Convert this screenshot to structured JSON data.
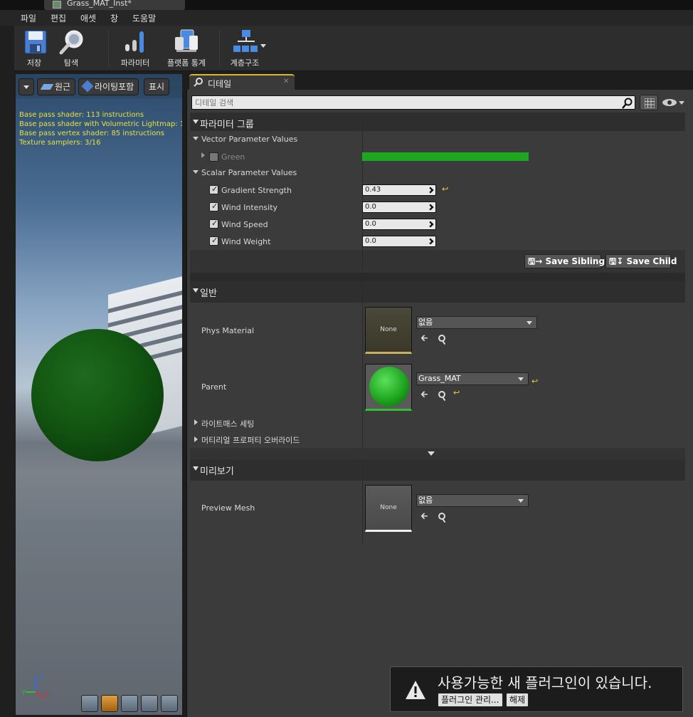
{
  "document_tab": {
    "title": "Grass_MAT_Inst*"
  },
  "menu": [
    "파일",
    "편집",
    "애셋",
    "창",
    "도움말"
  ],
  "toolbar": {
    "save_label": "저장",
    "browse_label": "탐색",
    "params_label": "파라미터",
    "platform_label": "플랫폼 통계",
    "hierarchy_label": "계층구조"
  },
  "viewport": {
    "perspective_label": "원근",
    "lighting_label": "라이팅포함",
    "show_label": "표시",
    "stats": [
      "Base pass shader: 113 instructions",
      "Base pass shader with Volumetric Lightmap: 1",
      "Base pass vertex shader: 85 instructions",
      "Texture samplers: 3/16"
    ],
    "gizmo": {
      "z": "Z",
      "y": "Y",
      "x": "X"
    }
  },
  "details": {
    "tab_label": "디테일",
    "tab_close": "✕",
    "search_placeholder": "디테일 검색",
    "param_group_label": "파라미터 그룹",
    "vector_section_label": "Vector Parameter Values",
    "vector_params": [
      {
        "name": "Green",
        "checked": false,
        "color": "#1fa61f"
      }
    ],
    "scalar_section_label": "Scalar Parameter Values",
    "scalar_params": [
      {
        "name": "Gradient Strength",
        "checked": true,
        "value": "0.43",
        "modified": true
      },
      {
        "name": "Wind Intensity",
        "checked": true,
        "value": "0.0",
        "modified": false
      },
      {
        "name": "Wind Speed",
        "checked": true,
        "value": "0.0",
        "modified": false
      },
      {
        "name": "Wind Weight",
        "checked": true,
        "value": "0.0",
        "modified": false
      }
    ],
    "save_sibling_label": "Save Sibling",
    "save_child_label": "Save Child",
    "general_label": "일반",
    "phys_material_label": "Phys Material",
    "phys_material_thumb": "None",
    "phys_material_value": "없음",
    "parent_label": "Parent",
    "parent_value": "Grass_MAT",
    "lightmass_label": "라이트매스 세팅",
    "material_override_label": "머티리얼 프로퍼티 오버라이드",
    "preview_label": "미리보기",
    "preview_mesh_label": "Preview Mesh",
    "preview_mesh_thumb": "None",
    "preview_mesh_value": "없음"
  },
  "notification": {
    "message": "사용가능한 새 플러그인이 있습니다.",
    "manage_label": "플러그인 관리...",
    "dismiss_label": "해제"
  },
  "colors": {
    "accent": "#d8b830",
    "green_param": "#1fa61f",
    "warning": "#e8e040"
  }
}
